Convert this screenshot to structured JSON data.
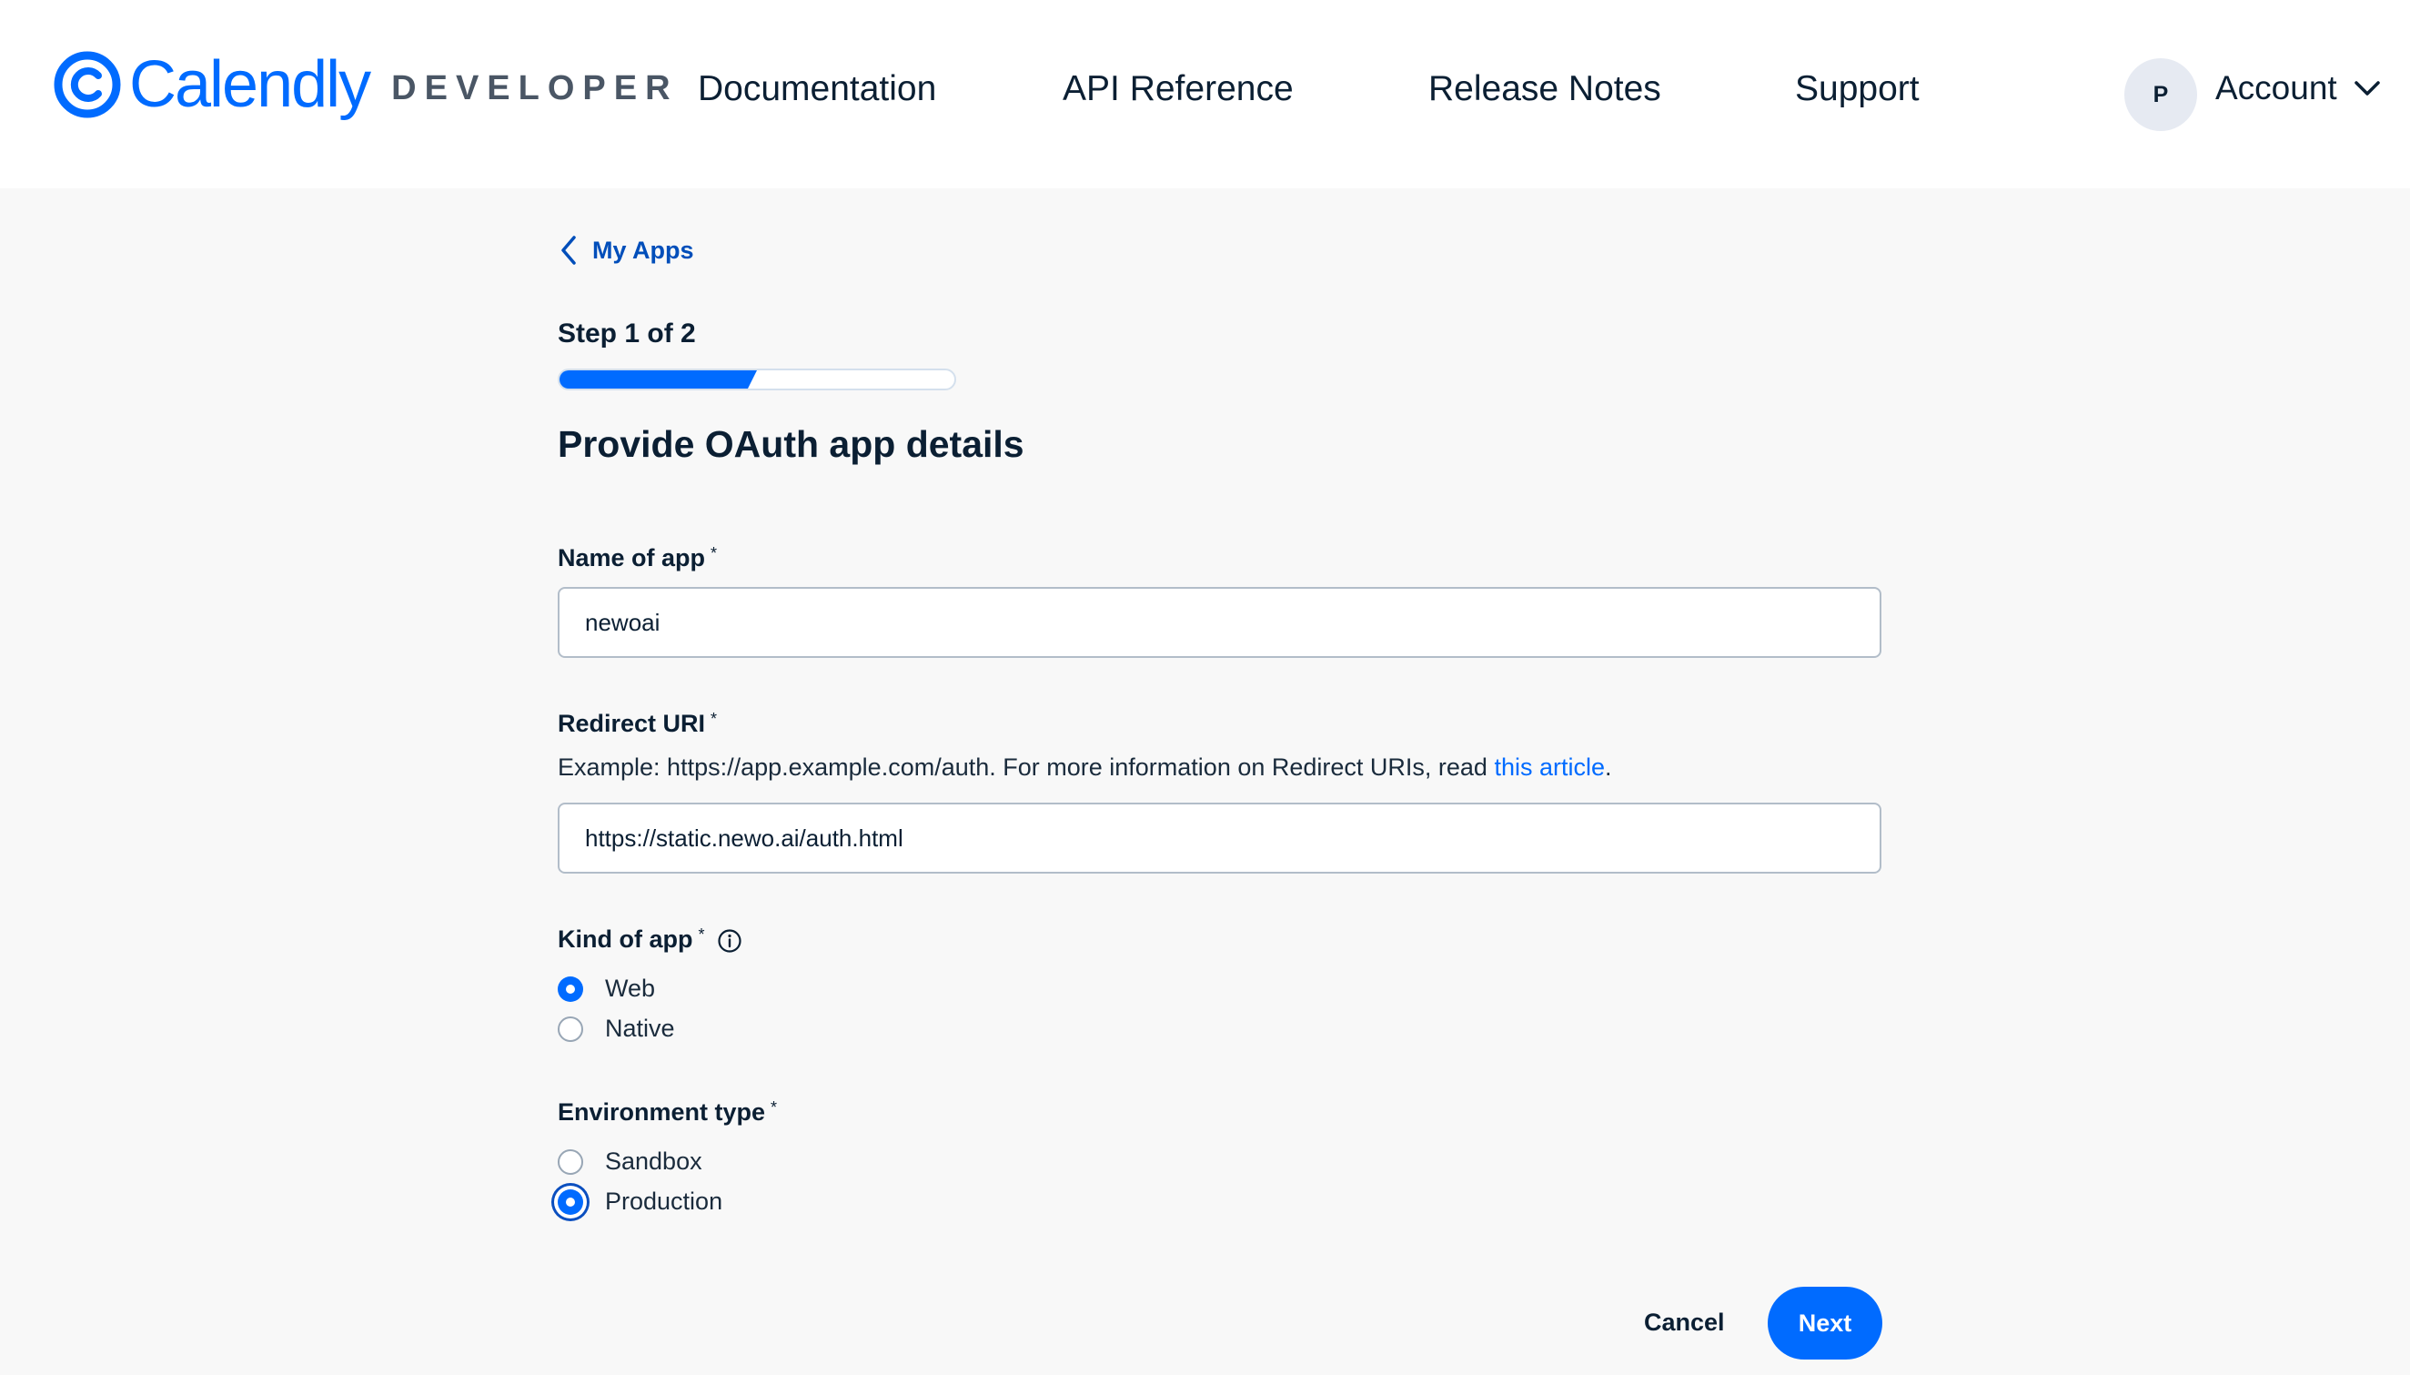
{
  "header": {
    "logo_word": "Calendly",
    "logo_suffix": "DEVELOPER",
    "nav": [
      "Documentation",
      "API Reference",
      "Release Notes",
      "Support"
    ],
    "avatar_initial": "P",
    "account_label": "Account"
  },
  "back_link": "My Apps",
  "step_label": "Step 1 of 2",
  "progress_fraction": 0.5,
  "page_title": "Provide OAuth app details",
  "form": {
    "name_label": "Name of app",
    "name_value": "newoai",
    "redirect_label": "Redirect URI",
    "redirect_hint": "Example: https://app.example.com/auth. For more information on Redirect URIs, read ",
    "redirect_hint_link": "this article",
    "redirect_hint_end": ".",
    "redirect_value": "https://static.newo.ai/auth.html",
    "kind_label": "Kind of app",
    "kind_options": [
      "Web",
      "Native"
    ],
    "kind_selected": "Web",
    "env_label": "Environment type",
    "env_options": [
      "Sandbox",
      "Production"
    ],
    "env_selected": "Production",
    "required_mark": "*"
  },
  "buttons": {
    "cancel": "Cancel",
    "next": "Next"
  },
  "colors": {
    "brand": "#006bff",
    "text": "#0b1f33",
    "background": "#f8f8f8"
  }
}
